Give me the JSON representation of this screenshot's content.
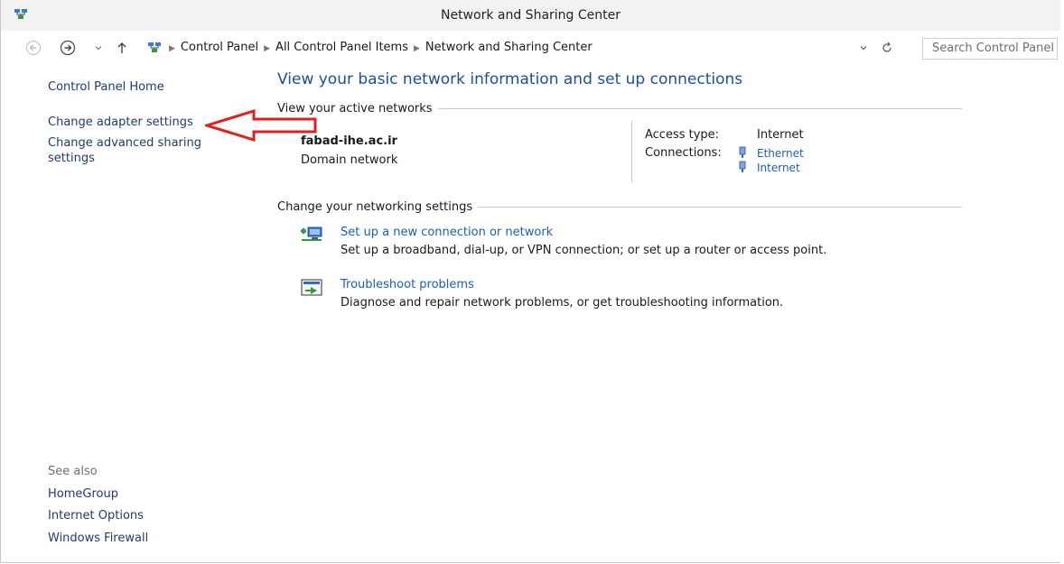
{
  "window": {
    "title": "Network and Sharing Center"
  },
  "address_bar": {
    "crumbs": [
      "Control Panel",
      "All Control Panel Items",
      "Network and Sharing Center"
    ],
    "search_placeholder": "Search Control Panel"
  },
  "left_panel": {
    "links": [
      "Control Panel Home",
      "Change adapter settings",
      "Change advanced sharing",
      "settings"
    ],
    "see_also_title": "See also",
    "see_also": [
      "HomeGroup",
      "Internet Options",
      "Windows Firewall"
    ]
  },
  "main": {
    "title": "View your basic network information and set up connections",
    "active_networks_heading": "View your active networks",
    "network": {
      "name": "fabad-ihe.ac.ir",
      "type": "Domain network",
      "access_type_label": "Access type:",
      "access_type_value": "Internet",
      "connections_label": "Connections:",
      "connections": [
        "Ethernet",
        "Internet"
      ]
    },
    "networking_settings_heading": "Change your networking settings",
    "tasks": [
      {
        "title": "Set up a new connection or network",
        "description": "Set up a broadband, dial-up, or VPN connection; or set up a router or access point.",
        "icon": "network-setup-icon"
      },
      {
        "title": "Troubleshoot problems",
        "description": "Diagnose and repair network problems, or get troubleshooting information.",
        "icon": "troubleshoot-icon"
      }
    ]
  },
  "annotation": {
    "arrow_color": "#e0201f"
  },
  "colors": {
    "link": "#1e5eb5",
    "title_blue": "#1e4e9a",
    "left_link": "#1e3c6e"
  }
}
